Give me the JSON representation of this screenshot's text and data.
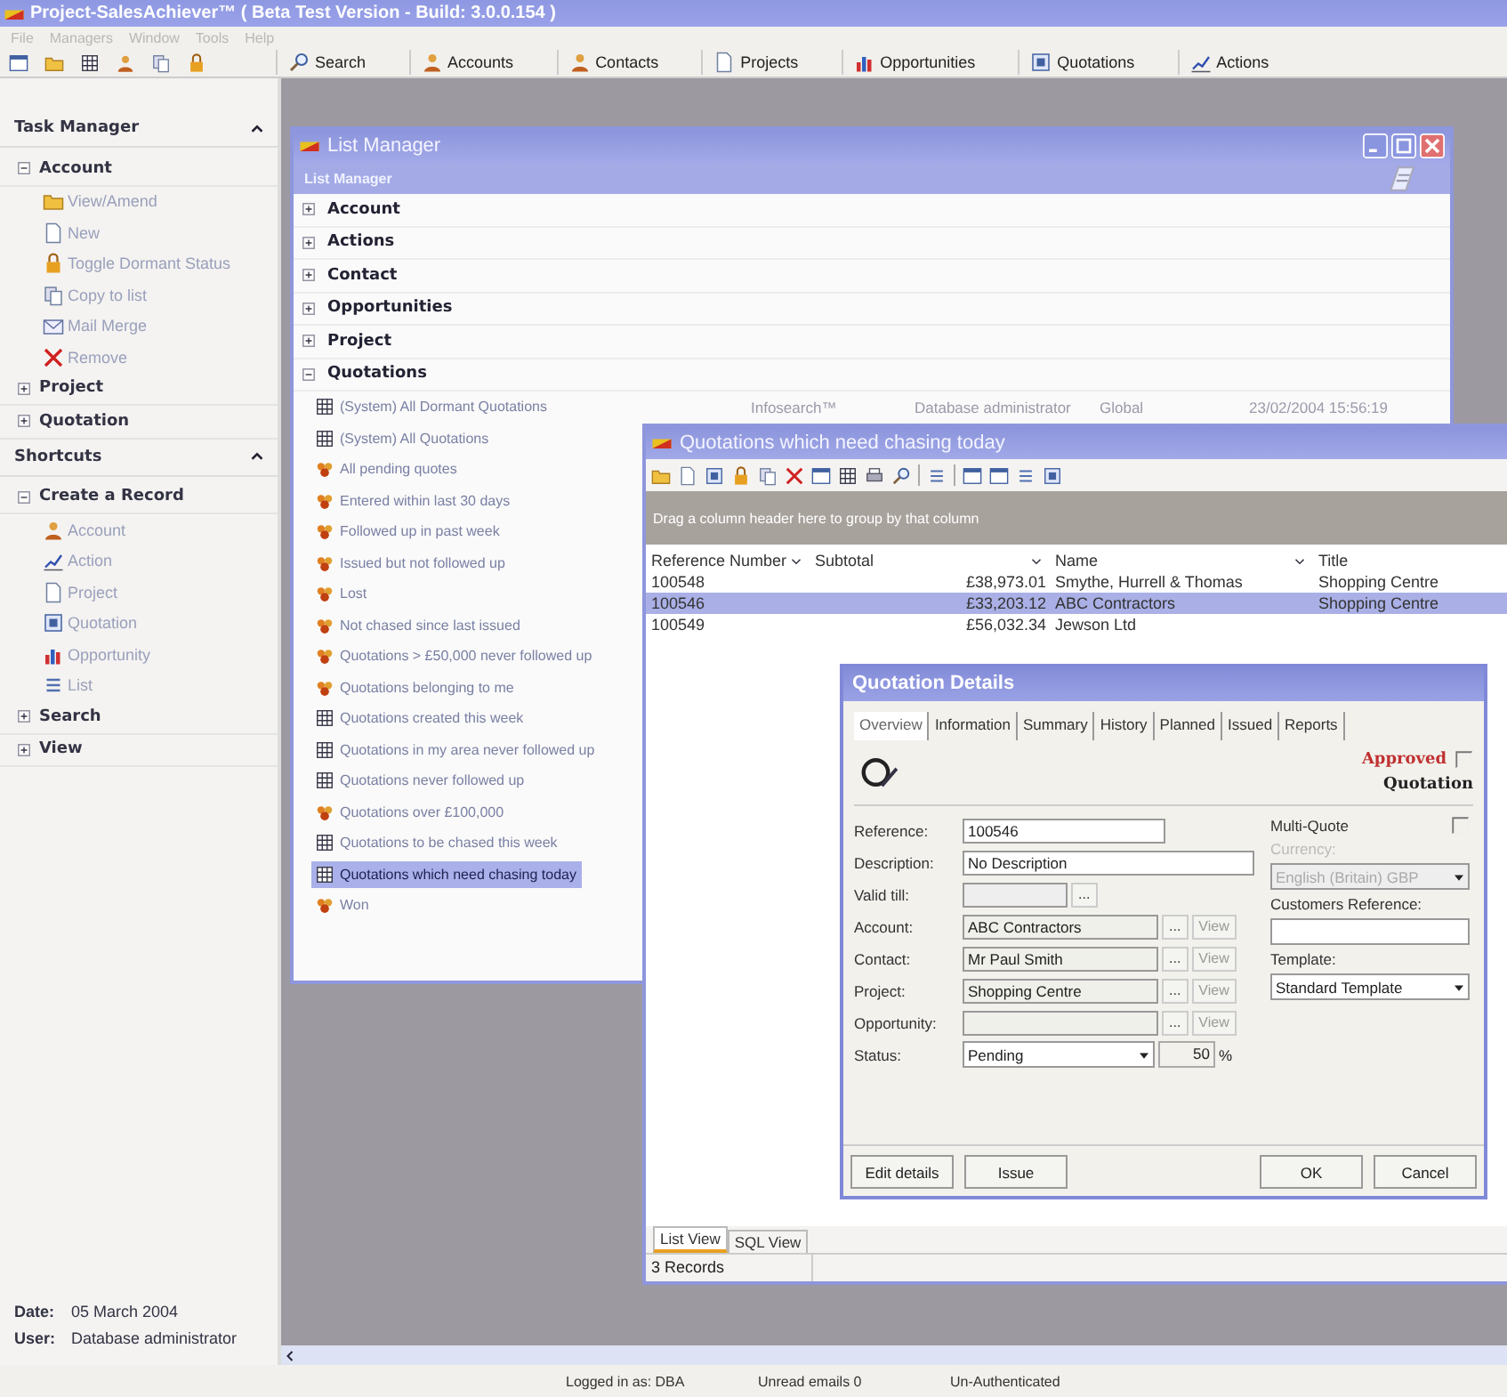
{
  "app": {
    "title": "Project-SalesAchiever™ ( Beta Test Version - Build: 3.0.0.154 )",
    "menu": [
      "File",
      "Managers",
      "Window",
      "Tools",
      "Help"
    ],
    "toolbar_buttons": [
      "Search",
      "Accounts",
      "Contacts",
      "Projects",
      "Opportunities",
      "Quotations",
      "Actions"
    ]
  },
  "task_manager": {
    "title": "Task Manager",
    "groups": [
      {
        "label": "Account",
        "expanded": true,
        "children": [
          "View/Amend",
          "New",
          "Toggle Dormant Status",
          "Copy to list",
          "Mail Merge",
          "Remove"
        ]
      },
      {
        "label": "Project",
        "expanded": false
      },
      {
        "label": "Quotation",
        "expanded": false
      }
    ]
  },
  "shortcuts": {
    "title": "Shortcuts",
    "groups": [
      {
        "label": "Create a Record",
        "expanded": true,
        "children": [
          "Account",
          "Action",
          "Project",
          "Quotation",
          "Opportunity",
          "List"
        ]
      },
      {
        "label": "Search",
        "expanded": false
      },
      {
        "label": "View",
        "expanded": false
      }
    ]
  },
  "session": [
    {
      "label": "Date:",
      "value": "05 March 2004"
    },
    {
      "label": "User:",
      "value": "Database administrator"
    }
  ],
  "list_manager": {
    "title": "List Manager",
    "header": "List Manager",
    "categories": [
      {
        "label": "Account",
        "expanded": false
      },
      {
        "label": "Actions",
        "expanded": false
      },
      {
        "label": "Contact",
        "expanded": false
      },
      {
        "label": "Opportunities",
        "expanded": false
      },
      {
        "label": "Project",
        "expanded": false
      },
      {
        "label": "Quotations",
        "expanded": true,
        "children": [
          {
            "label": "(System) All Dormant Quotations",
            "kind": "system",
            "selected": false,
            "details": [
              "Infosearch™",
              "Database administrator",
              "Global",
              "23/02/2004 15:56:19"
            ]
          },
          {
            "label": "(System) All Quotations",
            "kind": "system",
            "selected": false
          },
          {
            "label": "All pending quotes",
            "kind": "query",
            "selected": false
          },
          {
            "label": "Entered within last 30 days",
            "kind": "query",
            "selected": false
          },
          {
            "label": "Followed up in past week",
            "kind": "query",
            "selected": false
          },
          {
            "label": "Issued but not followed up",
            "kind": "query",
            "selected": false
          },
          {
            "label": "Lost",
            "kind": "query",
            "selected": false
          },
          {
            "label": "Not chased since last issued",
            "kind": "query",
            "selected": false
          },
          {
            "label": "Quotations > £50,000 never followed up",
            "kind": "query",
            "selected": false
          },
          {
            "label": "Quotations belonging to me",
            "kind": "query",
            "selected": false
          },
          {
            "label": "Quotations created this week",
            "kind": "system",
            "selected": false
          },
          {
            "label": "Quotations in my area never followed up",
            "kind": "system",
            "selected": false
          },
          {
            "label": "Quotations never followed up",
            "kind": "system",
            "selected": false
          },
          {
            "label": "Quotations over £100,000",
            "kind": "query",
            "selected": false
          },
          {
            "label": "Quotations to be chased this week",
            "kind": "system",
            "selected": false
          },
          {
            "label": "Quotations which need chasing today",
            "kind": "system",
            "selected": true
          },
          {
            "label": "Won",
            "kind": "query",
            "selected": false
          }
        ]
      }
    ]
  },
  "quotations_window": {
    "title": "Quotations which need chasing today",
    "group_hint": "Drag a column header here to group by that column",
    "columns": [
      "Reference Number",
      "Subtotal",
      "Name",
      "Title"
    ],
    "rows": [
      {
        "cells": [
          "100548",
          "£38,973.01",
          "Smythe, Hurrell & Thomas",
          "Shopping Centre"
        ],
        "selected": false
      },
      {
        "cells": [
          "100546",
          "£33,203.12",
          "ABC Contractors",
          "Shopping Centre"
        ],
        "selected": true
      },
      {
        "cells": [
          "100549",
          "£56,032.34",
          "Jewson Ltd",
          ""
        ],
        "selected": false
      }
    ],
    "tabs": [
      {
        "label": "List View",
        "selected": true
      },
      {
        "label": "SQL View",
        "selected": false
      }
    ],
    "record_count": "3 Records"
  },
  "quotation_details": {
    "title": "Quotation Details",
    "tabs": [
      {
        "label": "Overview",
        "selected": true
      },
      {
        "label": "Information",
        "selected": false
      },
      {
        "label": "Summary",
        "selected": false
      },
      {
        "label": "History",
        "selected": false
      },
      {
        "label": "Planned",
        "selected": false
      },
      {
        "label": "Issued",
        "selected": false
      },
      {
        "label": "Reports",
        "selected": false
      }
    ],
    "approved": {
      "label": "Approved",
      "checked": false
    },
    "record_type": "Quotation",
    "fields": [
      {
        "label": "Reference:",
        "value": "100546",
        "kind": "text"
      },
      {
        "label": "Description:",
        "value": "No Description",
        "kind": "wide"
      },
      {
        "label": "Valid till:",
        "kind": "date",
        "browse": "..."
      },
      {
        "label": "Account:",
        "value": "ABC Contractors",
        "kind": "lookup",
        "browse": "...",
        "view": "View"
      },
      {
        "label": "Contact:",
        "value": "Mr Paul Smith",
        "kind": "lookup",
        "browse": "...",
        "view": "View"
      },
      {
        "label": "Project:",
        "value": "Shopping Centre",
        "kind": "lookup",
        "browse": "...",
        "view": "View"
      },
      {
        "label": "Opportunity:",
        "kind": "lookup",
        "browse": "...",
        "view": "View"
      },
      {
        "label": "Status:",
        "value": "Pending",
        "kind": "status",
        "percent": "50",
        "unit": "%"
      }
    ],
    "multi_quote": {
      "label": "Multi-Quote",
      "checked": false
    },
    "currency": {
      "label": "Currency:",
      "value": "English (Britain) GBP",
      "disabled": true
    },
    "customers_reference": {
      "label": "Customers Reference:"
    },
    "template": {
      "label": "Template:",
      "value": "Standard Template"
    },
    "buttons": [
      "Edit details",
      "Issue",
      "OK",
      "Cancel"
    ]
  },
  "status_bar": [
    "Logged in as: DBA",
    "Unread emails 0",
    "Un-Authenticated"
  ]
}
